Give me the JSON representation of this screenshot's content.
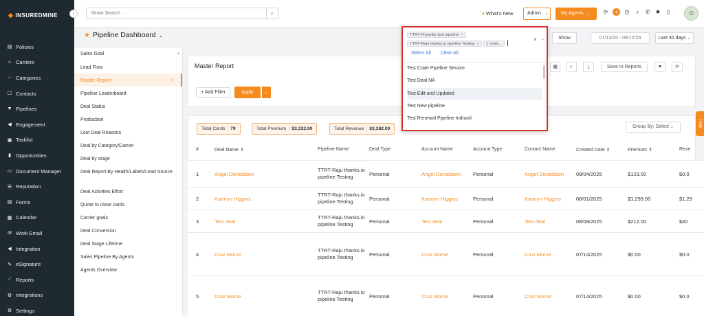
{
  "app": {
    "logo": "INSUREDMINE"
  },
  "sidebar": {
    "items": [
      {
        "label": "Policies",
        "icon": "document-icon",
        "glyph": "▤"
      },
      {
        "label": "Carriers",
        "icon": "bank-icon",
        "glyph": "⌂"
      },
      {
        "label": "Categories",
        "icon": "dots-icon",
        "glyph": "⁘"
      },
      {
        "label": "Contacts",
        "icon": "contact-card-icon",
        "glyph": "☐"
      },
      {
        "label": "Pipelines",
        "icon": "funnel-icon",
        "glyph": "▼"
      },
      {
        "label": "Engagement",
        "icon": "megaphone-icon",
        "glyph": "◀"
      },
      {
        "label": "Tasklist",
        "icon": "tasklist-icon",
        "glyph": "▣"
      },
      {
        "label": "Opportunities",
        "icon": "bar-chart-icon",
        "glyph": "▮"
      },
      {
        "label": "Document Manager",
        "icon": "folder-icon",
        "glyph": "▭"
      },
      {
        "label": "Reputation",
        "icon": "reputation-icon",
        "glyph": "☰"
      },
      {
        "label": "Forms",
        "icon": "forms-icon",
        "glyph": "▤"
      },
      {
        "label": "Calendar",
        "icon": "calendar-icon",
        "glyph": "▦"
      },
      {
        "label": "Work Email",
        "icon": "email-icon",
        "glyph": "✉"
      },
      {
        "label": "Integration",
        "icon": "megaphone-icon",
        "glyph": "◀"
      },
      {
        "label": "eSignature",
        "icon": "signature-icon",
        "glyph": "✎"
      },
      {
        "label": "Reports",
        "icon": "line-chart-icon",
        "glyph": "⟋"
      },
      {
        "label": "Integrations",
        "icon": "gears-icon",
        "glyph": "⚙"
      },
      {
        "label": "Settings",
        "icon": "gear-icon",
        "glyph": "⚙"
      }
    ]
  },
  "topbar": {
    "search_placeholder": "Smart Search",
    "whats_new": "What's New",
    "admin_select": "Admin",
    "my_agents": "My Agents"
  },
  "dashboard": {
    "title": "Pipeline Dashboard",
    "show_label": "Show",
    "date_range": "07/13/25 - 08/12/25",
    "period": "Last 30 days"
  },
  "report_menu": [
    "Sales Goal",
    "Lead Flow",
    "Master Report",
    "Pipeline Leaderboard",
    "Deal Status",
    "Production",
    "Lost Deal Reasons",
    "Deal by Category/Carrier",
    "Deal by stage",
    "Deal Report By Health/Labels/Lead Source",
    "Deal Activities Effort",
    "Quote to close cards",
    "Carrier goals",
    "Deal Conversion",
    "Deal Stage Lifetime",
    "Sales Pipeline By Agents",
    "Agents Overview"
  ],
  "master_report": {
    "title": "Master Report",
    "add_filter": "+ Add Filter",
    "apply": "Apply",
    "save_to_reports": "Save to Reports",
    "stats": [
      {
        "label": "Total Cards",
        "value": "79"
      },
      {
        "label": "Total Premium",
        "value": "$3,332.00"
      },
      {
        "label": "Total Revenue",
        "value": "$3,382.00"
      }
    ],
    "group_by": "Group By: Select"
  },
  "table": {
    "headers": [
      "#",
      "Deal Name ⇕",
      "Pipeline Name",
      "Deal Type",
      "Account Name",
      "Account Type",
      "Contact Name",
      "Created Date ⇕",
      "Premium ⇕",
      "Reve"
    ],
    "rows": [
      {
        "num": "1",
        "deal": "Angel Donaldson",
        "pipeline": "TTRT-Raju thanks.io pipeline Testing",
        "type": "Personal",
        "account": "Angel Donaldson",
        "acc_type": "Personal",
        "contact": "Angel Donaldson",
        "date": "08/04/2025",
        "premium": "$123.00",
        "revenue": "$0.0"
      },
      {
        "num": "2",
        "deal": "Kamryn Higgins",
        "pipeline": "TTRT-Raju thanks.io pipeline Testing",
        "type": "Personal",
        "account": "Kamryn Higgins",
        "acc_type": "Personal",
        "contact": "Kamryn Higgins",
        "date": "08/01/2025",
        "premium": "$1,299.00",
        "revenue": "$1,29"
      },
      {
        "num": "3",
        "deal": "Test deal",
        "pipeline": "TTRT-Raju thanks.io pipeline Testing",
        "type": "Personal",
        "account": "Test deal",
        "acc_type": "Personal",
        "contact": "Test deal",
        "date": "08/08/2025",
        "premium": "$212.00",
        "revenue": "$40"
      },
      {
        "num": "4",
        "deal": "Cruz Morse",
        "pipeline": "TTRT-Raju thanks.io pipeline Testing",
        "type": "Personal",
        "account": "Cruz Morse",
        "acc_type": "Personal",
        "contact": "Cruz Morse",
        "date": "07/14/2025",
        "premium": "$0.00",
        "revenue": "$0.0"
      },
      {
        "num": "5",
        "deal": "Cruz Morse",
        "pipeline": "TTRT-Raju thanks.io pipeline Testing",
        "type": "Personal",
        "account": "Cruz Morse",
        "acc_type": "Personal",
        "contact": "Cruz Morse",
        "date": "07/14/2025",
        "premium": "$0.00",
        "revenue": "$0.0"
      }
    ]
  },
  "pipeline_dropdown": {
    "tags": [
      "TTRT-Priyanka test pipeline",
      "TTRT-Raju thanks.io pipeline Testing"
    ],
    "more": "1 more...",
    "select_all": "Select All",
    "clear_all": "Clear All",
    "options": [
      "Test Crate Pipeline Service",
      "Test Deal NA",
      "Test Edit and Updated",
      "Test New pipeline",
      "Test Renewal Pipeline Indranil"
    ],
    "highlighted_index": 2
  },
  "help_tab": "Help",
  "colors": {
    "accent": "#f58a1f",
    "sidebar_bg": "#1f2a30",
    "link": "#3a7bd5",
    "highlight_border": "#d9302c"
  }
}
